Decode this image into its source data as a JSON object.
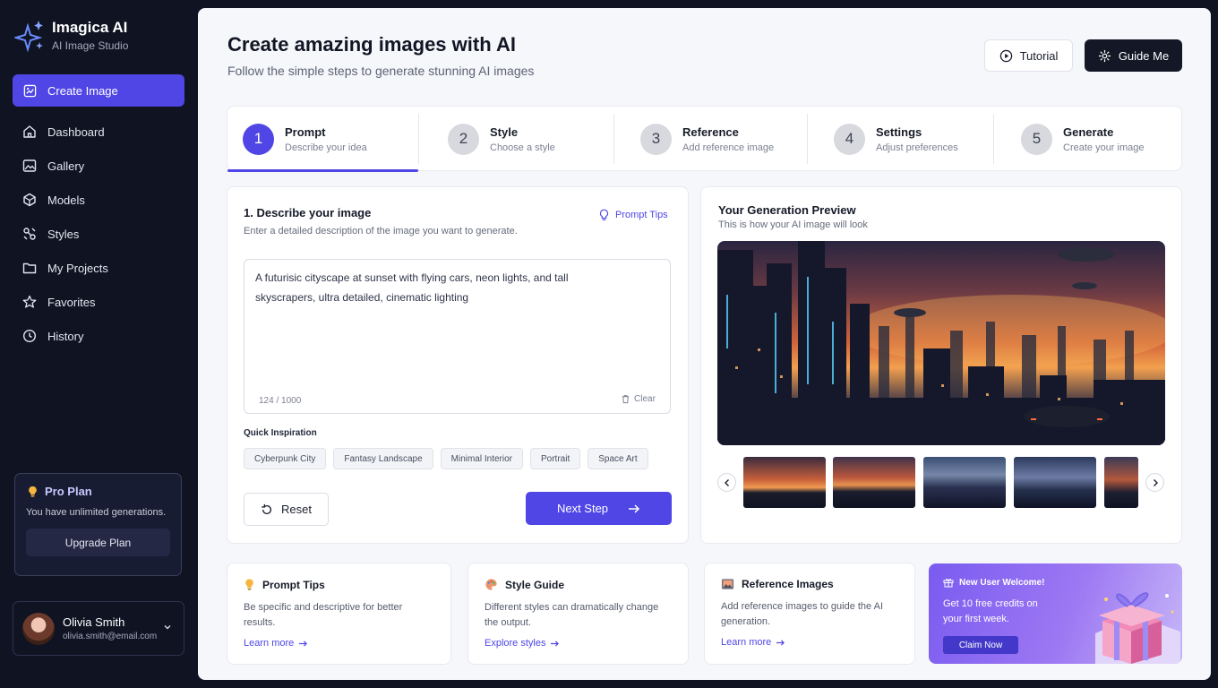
{
  "brand": {
    "name": "Imagica AI",
    "subtitle": "AI Image Studio"
  },
  "sidebar": {
    "primary_action": "Create Image",
    "items": [
      {
        "label": "Dashboard",
        "icon": "home-icon"
      },
      {
        "label": "Gallery",
        "icon": "image-icon"
      },
      {
        "label": "Models",
        "icon": "cube-icon"
      },
      {
        "label": "Styles",
        "icon": "styles-icon"
      },
      {
        "label": "My Projects",
        "icon": "folder-icon"
      },
      {
        "label": "Favorites",
        "icon": "star-icon"
      },
      {
        "label": "History",
        "icon": "history-icon"
      }
    ]
  },
  "plan": {
    "title": "Pro Plan",
    "text": "You have unlimited generations.",
    "button": "Upgrade Plan"
  },
  "user": {
    "name": "Olivia Smith",
    "email": "olivia.smith@email.com"
  },
  "header": {
    "title": "Create amazing images with AI",
    "subtitle": "Follow the simple steps to generate stunning AI images",
    "tutorial": "Tutorial",
    "guide": "Guide Me"
  },
  "steps": [
    {
      "num": "1",
      "title": "Prompt",
      "desc": "Describe your idea"
    },
    {
      "num": "2",
      "title": "Style",
      "desc": "Choose a style"
    },
    {
      "num": "3",
      "title": "Reference",
      "desc": "Add reference image"
    },
    {
      "num": "4",
      "title": "Settings",
      "desc": "Adjust preferences"
    },
    {
      "num": "5",
      "title": "Generate",
      "desc": "Create your image"
    }
  ],
  "prompt": {
    "title": "1. Describe your image",
    "subtitle": "Enter a detailed description of the image you want to generate.",
    "tips": "Prompt Tips",
    "text": "A futurisic cityscape at sunset with flying cars, neon lights, and tall skyscrapers, ultra detailed, cinematic lighting",
    "count": "124 / 1000",
    "clear": "Clear",
    "inspiration_label": "Quick Inspiration",
    "chips": [
      "Cyberpunk City",
      "Fantasy Landscape",
      "Minimal Interior",
      "Portrait",
      "Space Art"
    ],
    "reset": "Reset",
    "next": "Next Step"
  },
  "preview": {
    "title": "Your Generation Preview",
    "subtitle": "This is how your AI image will look"
  },
  "info_cards": [
    {
      "title": "Prompt Tips",
      "text": "Be specific and descriptive for better results.",
      "link": "Learn more"
    },
    {
      "title": "Style Guide",
      "text": "Different styles can dramatically change the output.",
      "link": "Explore styles"
    },
    {
      "title": "Reference Images",
      "text": "Add reference images to guide the AI generation.",
      "link": "Learn more"
    }
  ],
  "promo": {
    "title": "New User Welcome!",
    "text": "Get 10 free credits on your first week.",
    "button": "Claim Now"
  },
  "colors": {
    "accent": "#4f46e5",
    "sidebar": "#0f1322",
    "dark_button": "#141826"
  }
}
